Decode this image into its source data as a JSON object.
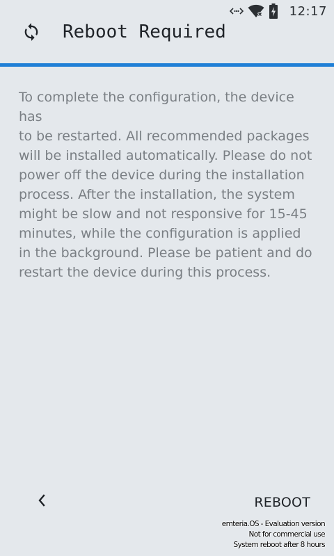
{
  "status_bar": {
    "time": "12:17",
    "icons": [
      "data-transfer-icon",
      "wifi-off-icon",
      "battery-charging-icon"
    ]
  },
  "header": {
    "icon": "sync-icon",
    "title": "Reboot Required",
    "accent_color": "#1f7fd6"
  },
  "message": {
    "lines": [
      "To complete the configuration, the device has",
      "to be restarted. All recommended packages",
      "will be installed automatically. Please do not",
      "power off the device during the installation",
      "process. After the installation, the system",
      "might be slow and not responsive for 15-45",
      "minutes, while the configuration is applied",
      "in the background. Please be patient and do",
      "restart the device during this process."
    ]
  },
  "footer": {
    "back_icon": "chevron-left-icon",
    "reboot_label": "REBOOT"
  },
  "watermark": {
    "line1": "emteria.OS - Evaluation version",
    "line2": "Not for commercial use",
    "line3": "System reboot after 8 hours"
  }
}
